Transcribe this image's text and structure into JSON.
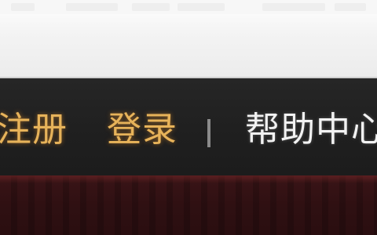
{
  "topnav": {
    "register_label": "注册",
    "login_label": "登录",
    "separator_label": "|",
    "help_center_label": "帮助中心"
  },
  "colors": {
    "nav_background": "#222222",
    "link_highlight": "#e7b35a",
    "link_default": "#f2f2f2",
    "banner_background": "#2f1012"
  }
}
